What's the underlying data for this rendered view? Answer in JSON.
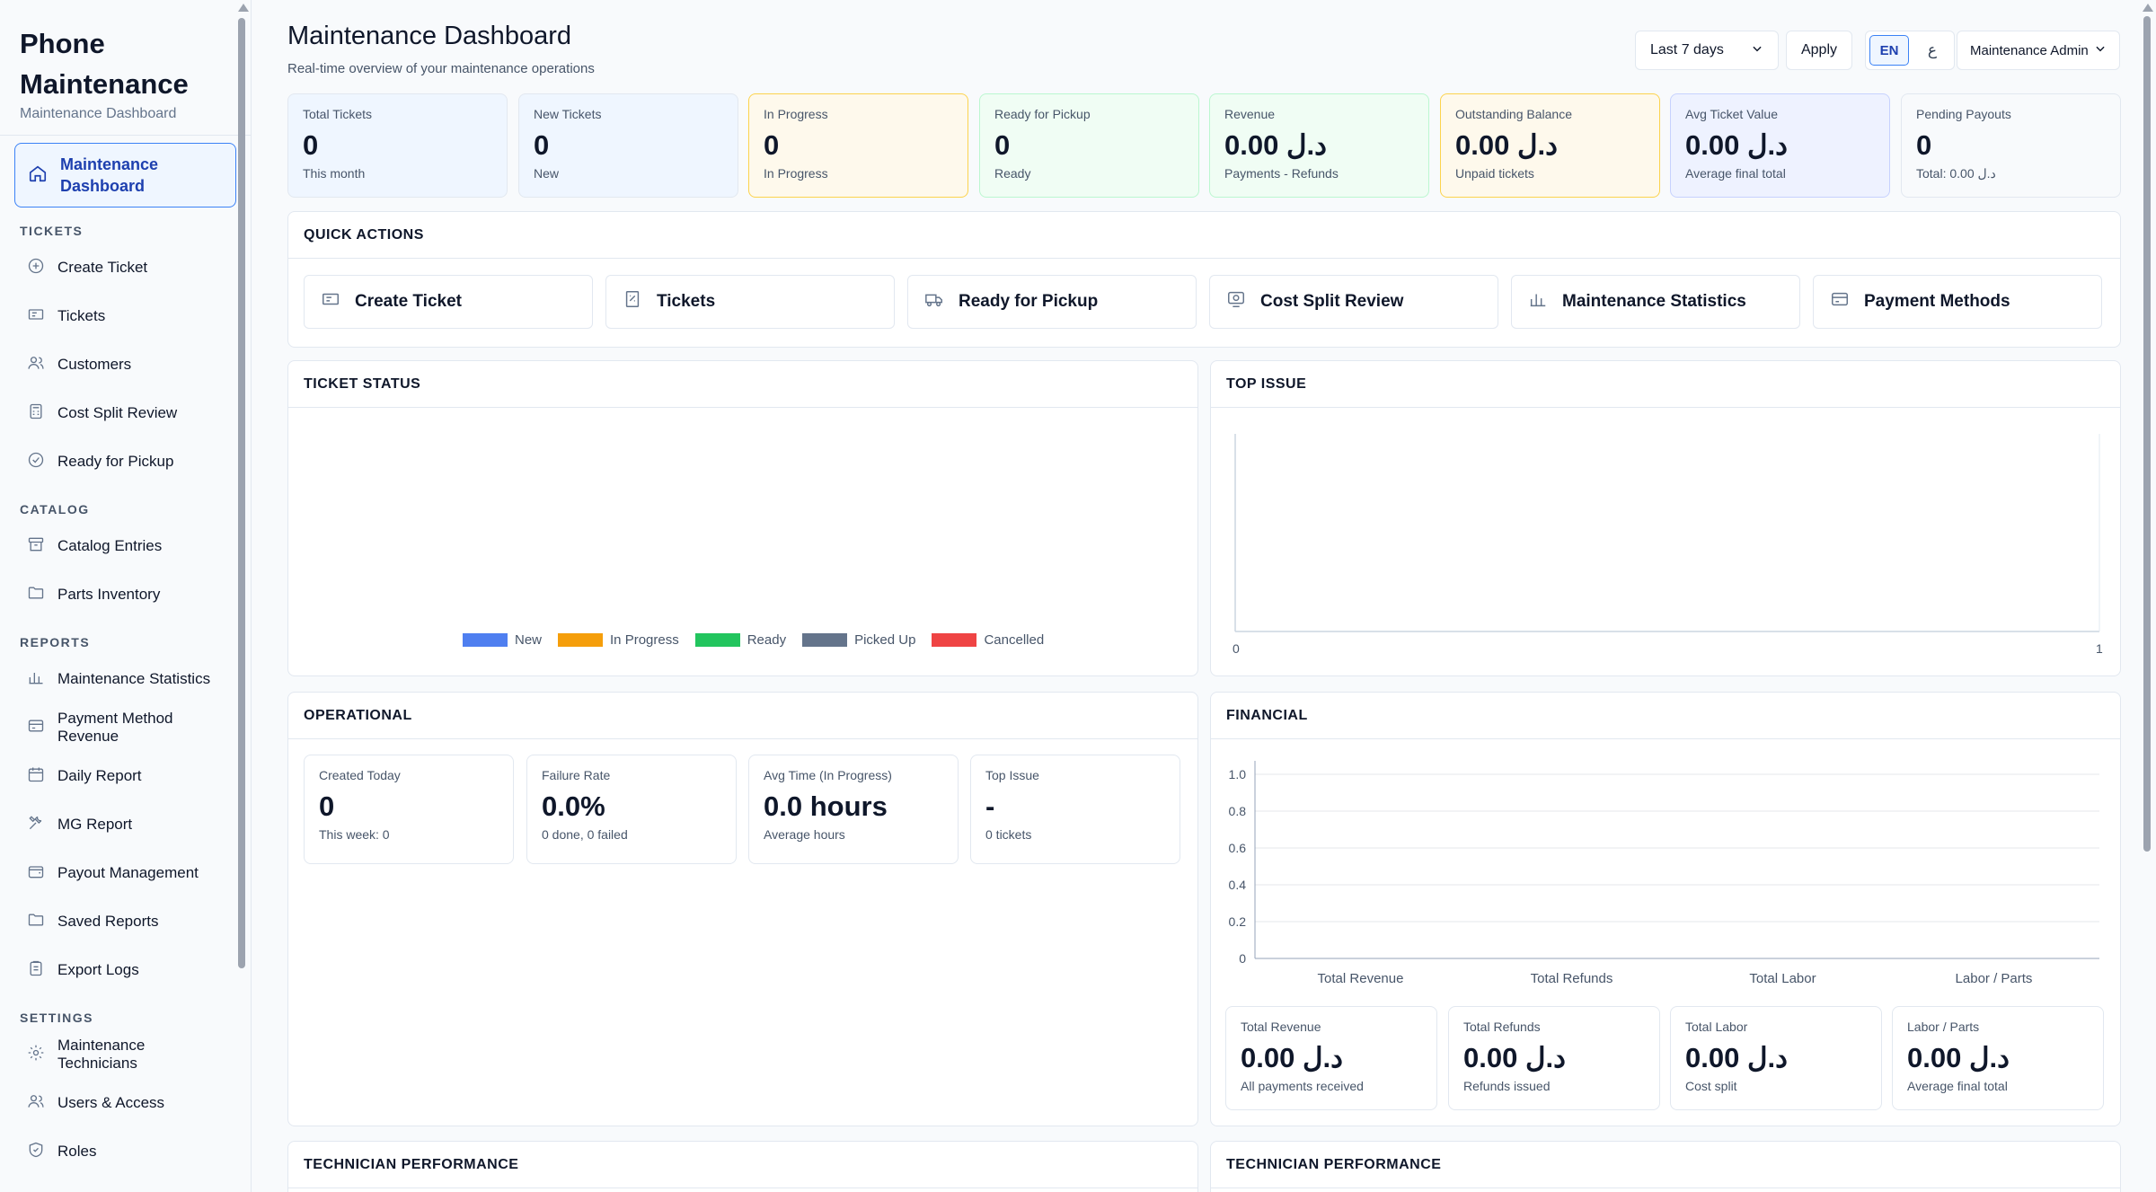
{
  "brand": {
    "title_line1": "Phone",
    "title_line2": "Maintenance",
    "subtitle": "Maintenance Dashboard"
  },
  "sidebar": {
    "active": {
      "label_line1": "Maintenance",
      "label_line2": "Dashboard"
    },
    "sections": [
      {
        "title": "TICKETS",
        "items": [
          "Create Ticket",
          "Tickets",
          "Customers",
          "Cost Split Review",
          "Ready for Pickup"
        ]
      },
      {
        "title": "CATALOG",
        "items": [
          "Catalog Entries",
          "Parts Inventory"
        ]
      },
      {
        "title": "REPORTS",
        "items": [
          "Maintenance Statistics",
          "Payment Method Revenue",
          "Daily Report",
          "MG Report",
          "Payout Management",
          "Saved Reports",
          "Export Logs"
        ]
      },
      {
        "title": "SETTINGS",
        "items": [
          "Maintenance Technicians",
          "Users & Access",
          "Roles"
        ]
      }
    ]
  },
  "header": {
    "title": "Maintenance Dashboard",
    "subtitle": "Real-time overview of your maintenance operations",
    "range_select": "Last 7 days",
    "apply": "Apply",
    "lang_en": "EN",
    "lang_ar": "ع",
    "user_menu": "Maintenance Admin"
  },
  "kpis": [
    {
      "label": "Total Tickets",
      "value": "0",
      "sub": "This month",
      "bg": "#eff6ff",
      "border": "#e2e8f0"
    },
    {
      "label": "New Tickets",
      "value": "0",
      "sub": "New",
      "bg": "#eff6ff",
      "border": "#e2e8f0"
    },
    {
      "label": "In Progress",
      "value": "0",
      "sub": "In Progress",
      "bg": "#fef9ec",
      "border": "#fcd34d"
    },
    {
      "label": "Ready for Pickup",
      "value": "0",
      "sub": "Ready",
      "bg": "#f0fdf4",
      "border": "#bbf7d0"
    },
    {
      "label": "Revenue",
      "value": "0.00 د.ل",
      "sub": "Payments - Refunds",
      "bg": "#f0fdf4",
      "border": "#bbf7d0"
    },
    {
      "label": "Outstanding Balance",
      "value": "0.00 د.ل",
      "sub": "Unpaid tickets",
      "bg": "#fef9ec",
      "border": "#fcd34d"
    },
    {
      "label": "Avg Ticket Value",
      "value": "0.00 د.ل",
      "sub": "Average final total",
      "bg": "#eef2ff",
      "border": "#c7d2fe"
    },
    {
      "label": "Pending Payouts",
      "value": "0",
      "sub": "Total: 0.00 د.ل",
      "bg": "#f8fafc",
      "border": "#e2e8f0"
    }
  ],
  "quick_actions": {
    "title": "QUICK ACTIONS",
    "items": [
      "Create Ticket",
      "Tickets",
      "Ready for Pickup",
      "Cost Split Review",
      "Maintenance Statistics",
      "Payment Methods"
    ]
  },
  "ticket_status": {
    "title": "TICKET STATUS",
    "legend": [
      {
        "label": "New",
        "color": "#4f7ff0"
      },
      {
        "label": "In Progress",
        "color": "#f59e0b"
      },
      {
        "label": "Ready",
        "color": "#22c55e"
      },
      {
        "label": "Picked Up",
        "color": "#64748b"
      },
      {
        "label": "Cancelled",
        "color": "#ef4444"
      }
    ]
  },
  "top_issue": {
    "title": "TOP ISSUE",
    "x_min": "0",
    "x_max": "1"
  },
  "operational": {
    "title": "OPERATIONAL",
    "cards": [
      {
        "label": "Created Today",
        "value": "0",
        "sub": "This week: 0"
      },
      {
        "label": "Failure Rate",
        "value": "0.0%",
        "sub": "0 done, 0 failed"
      },
      {
        "label": "Avg Time (In Progress)",
        "value": "0.0 hours",
        "sub": "Average hours"
      },
      {
        "label": "Top Issue",
        "value": "-",
        "sub": "0 tickets"
      }
    ]
  },
  "financial": {
    "title": "FINANCIAL",
    "cards": [
      {
        "label": "Total Revenue",
        "value": "0.00 د.ل",
        "sub": "All payments received"
      },
      {
        "label": "Total Refunds",
        "value": "0.00 د.ل",
        "sub": "Refunds issued"
      },
      {
        "label": "Total Labor",
        "value": "0.00 د.ل",
        "sub": "Cost split"
      },
      {
        "label": "Labor / Parts",
        "value": "0.00 د.ل",
        "sub": "Average final total"
      }
    ]
  },
  "chart_data": {
    "type": "bar",
    "categories": [
      "Total Revenue",
      "Total Refunds",
      "Total Labor",
      "Labor / Parts"
    ],
    "values": [
      0,
      0,
      0,
      0
    ],
    "yticks": [
      "0",
      "0.2",
      "0.4",
      "0.6",
      "0.8",
      "1.0"
    ],
    "ylim": [
      0,
      1.0
    ],
    "grid": true
  },
  "tech_perf": {
    "title_left": "TECHNICIAN PERFORMANCE",
    "title_right": "TECHNICIAN PERFORMANCE"
  }
}
